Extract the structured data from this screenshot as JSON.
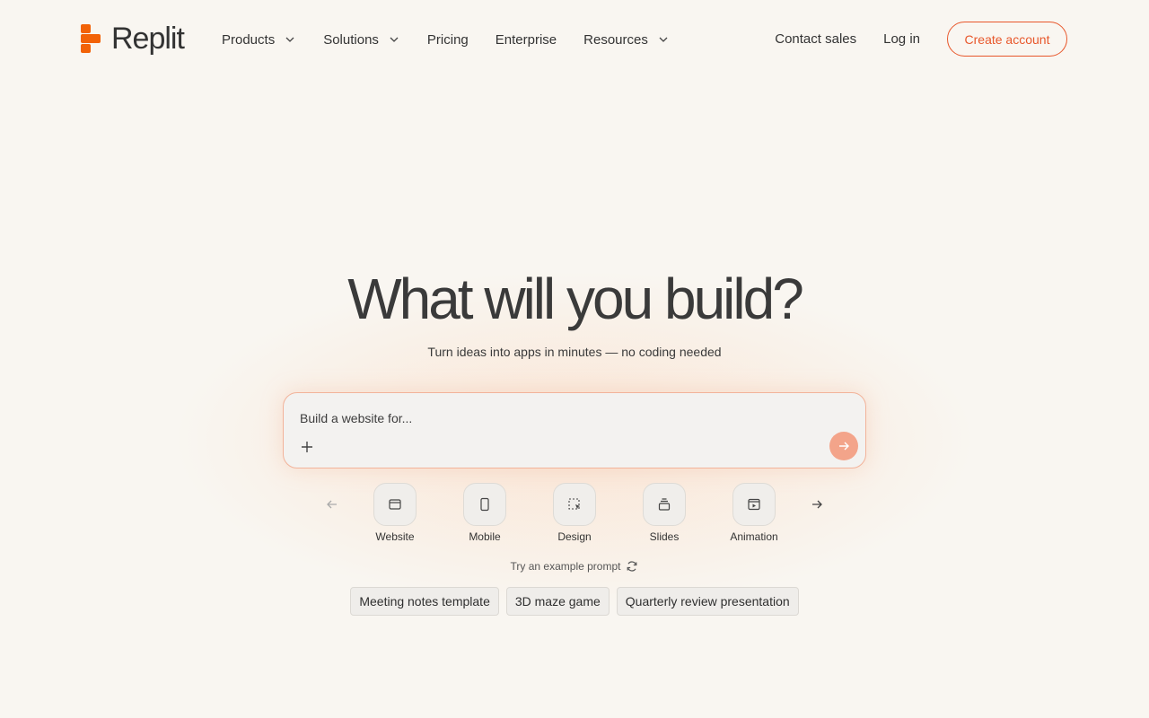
{
  "brand": {
    "name": "Replit",
    "accent": "#e8572b"
  },
  "nav": {
    "items": [
      {
        "label": "Products",
        "has_dropdown": true
      },
      {
        "label": "Solutions",
        "has_dropdown": true
      },
      {
        "label": "Pricing",
        "has_dropdown": false
      },
      {
        "label": "Enterprise",
        "has_dropdown": false
      },
      {
        "label": "Resources",
        "has_dropdown": true
      }
    ],
    "contact_sales": "Contact sales",
    "login": "Log in",
    "create_account": "Create account"
  },
  "hero": {
    "title": "What will you build?",
    "subtitle": "Turn ideas into apps in minutes — no coding needed"
  },
  "prompt": {
    "placeholder": "Build a website for...",
    "value": ""
  },
  "app_types": [
    {
      "label": "Website",
      "icon": "browser-window-icon"
    },
    {
      "label": "Mobile",
      "icon": "mobile-phone-icon"
    },
    {
      "label": "Design",
      "icon": "design-select-icon"
    },
    {
      "label": "Slides",
      "icon": "slides-stack-icon"
    },
    {
      "label": "Animation",
      "icon": "animation-play-icon"
    }
  ],
  "examples": {
    "label": "Try an example prompt",
    "chips": [
      "Meeting notes template",
      "3D maze game",
      "Quarterly review presentation"
    ]
  }
}
